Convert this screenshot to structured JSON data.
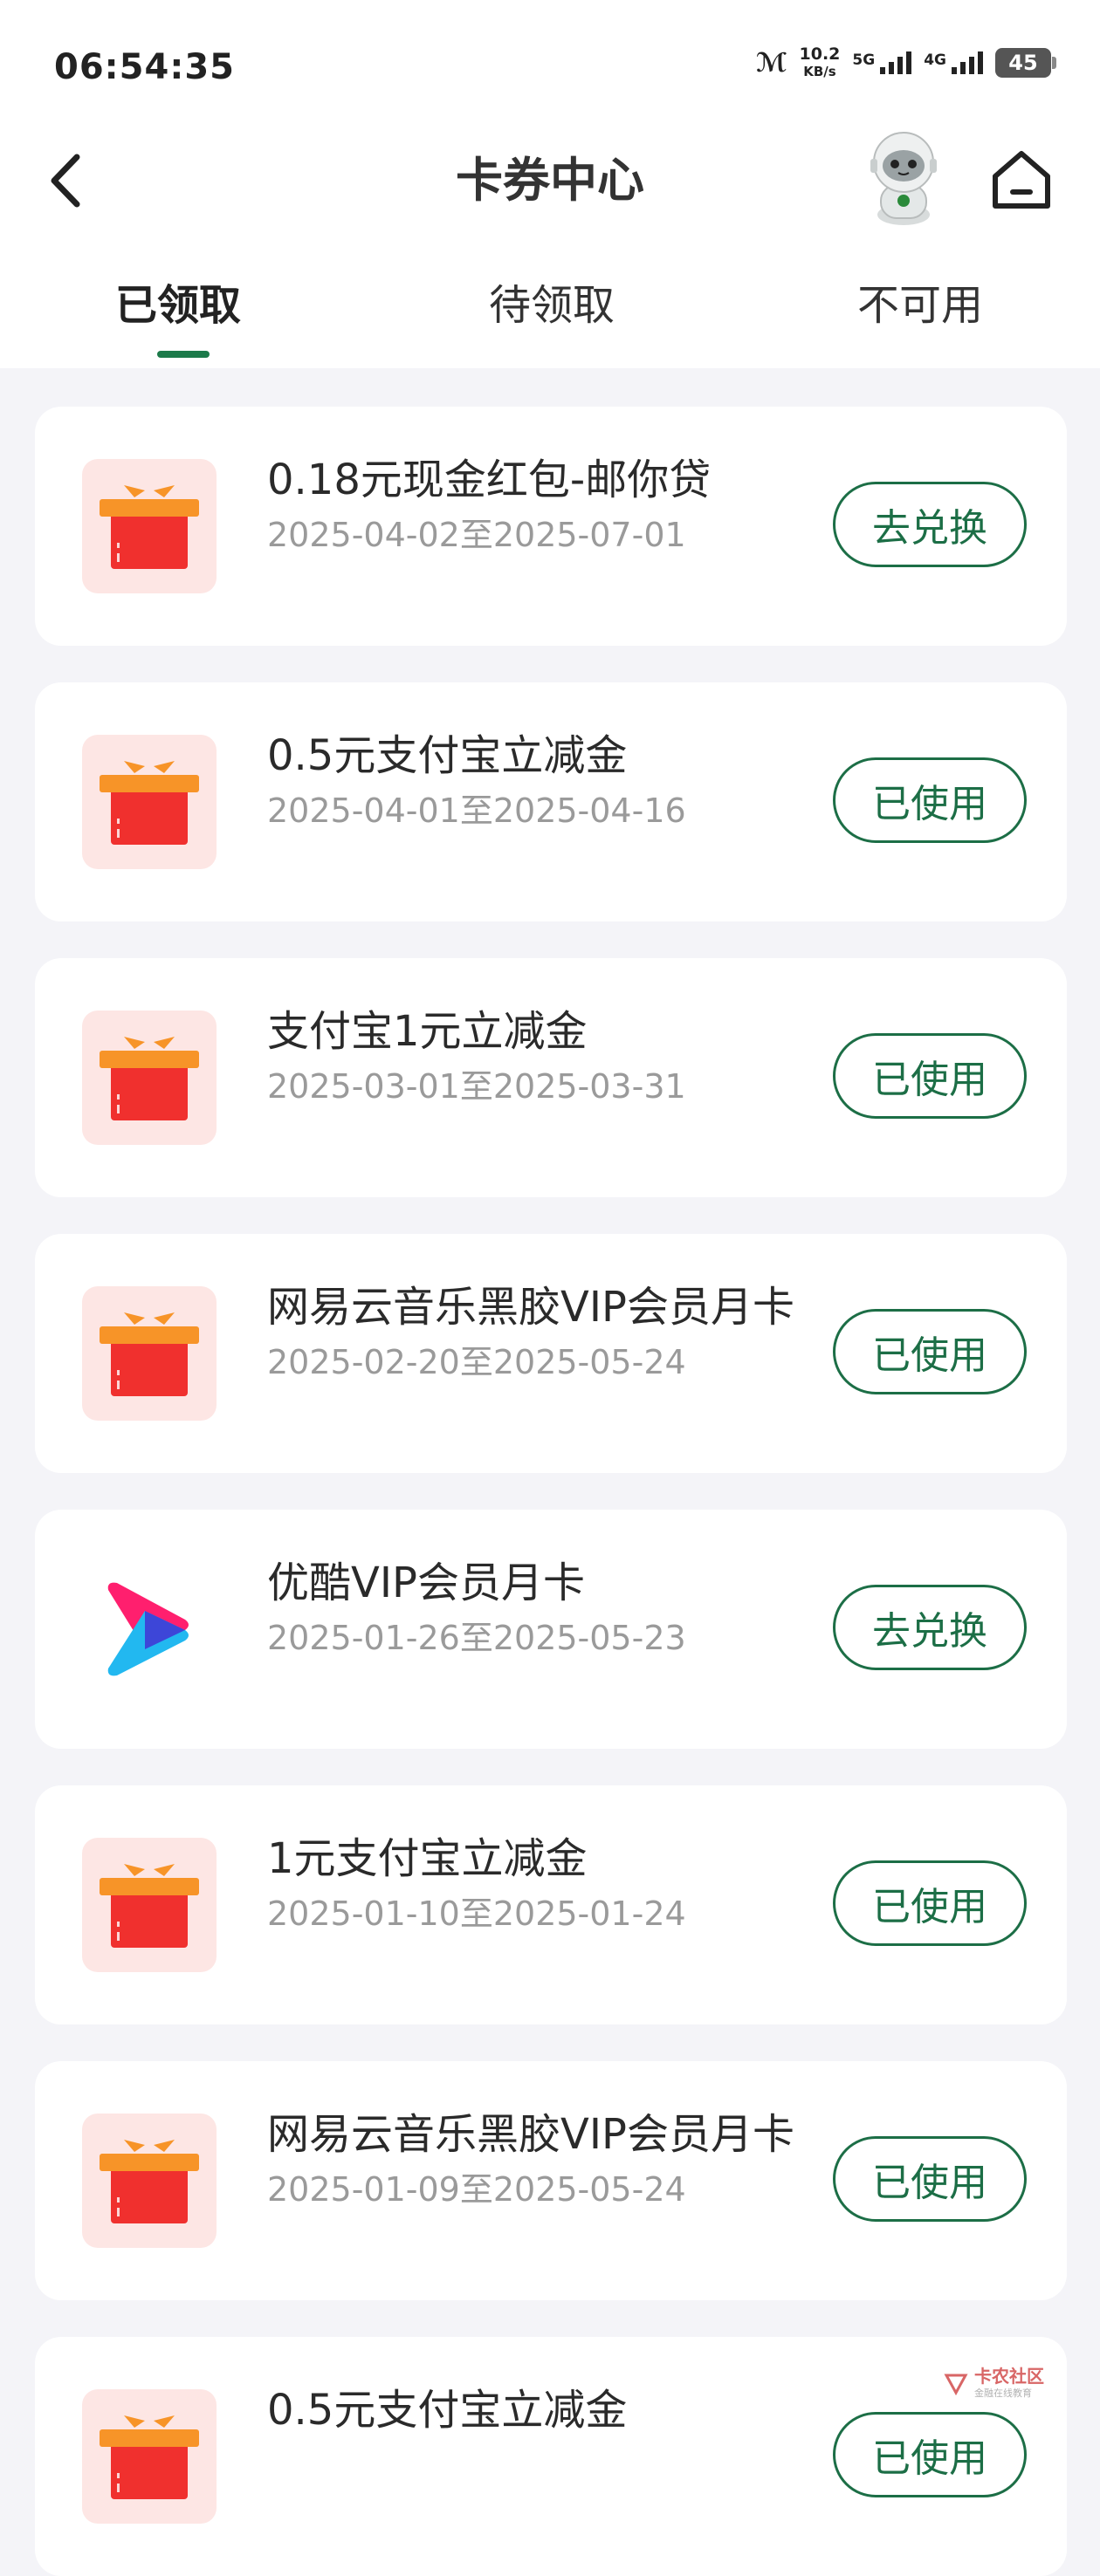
{
  "status_bar": {
    "time": "06:54:35",
    "net_speed_value": "10.2",
    "net_speed_unit": "KB/s",
    "sim1_label": "5G",
    "sim2_label": "4G",
    "battery": "45"
  },
  "header": {
    "title": "卡券中心"
  },
  "tabs": [
    {
      "label": "已领取",
      "active": true
    },
    {
      "label": "待领取",
      "active": false
    },
    {
      "label": "不可用",
      "active": false
    }
  ],
  "coupons": [
    {
      "icon": "gift-icon",
      "title": "0.18元现金红包-邮你贷",
      "date": "2025-04-02至2025-07-01",
      "action": "去兑换"
    },
    {
      "icon": "gift-icon",
      "title": "0.5元支付宝立减金",
      "date": "2025-04-01至2025-04-16",
      "action": "已使用"
    },
    {
      "icon": "gift-icon",
      "title": "支付宝1元立减金",
      "date": "2025-03-01至2025-03-31",
      "action": "已使用"
    },
    {
      "icon": "gift-icon",
      "title": "网易云音乐黑胶VIP会员月卡",
      "date": "2025-02-20至2025-05-24",
      "action": "已使用"
    },
    {
      "icon": "youku-logo-icon",
      "title": "优酷VIP会员月卡",
      "date": "2025-01-26至2025-05-23",
      "action": "去兑换"
    },
    {
      "icon": "gift-icon",
      "title": "1元支付宝立减金",
      "date": "2025-01-10至2025-01-24",
      "action": "已使用"
    },
    {
      "icon": "gift-icon",
      "title": "网易云音乐黑胶VIP会员月卡",
      "date": "2025-01-09至2025-05-24",
      "action": "已使用"
    },
    {
      "icon": "gift-icon",
      "title": "0.5元支付宝立减金",
      "date": "",
      "action": "已使用"
    }
  ],
  "watermark": {
    "text": "卡农社区",
    "sub": "金融在线教育"
  },
  "colors": {
    "accent_green": "#1c6e46",
    "tab_indicator": "#1c7a4a",
    "gift_red": "#f0302e",
    "gift_orange": "#f79428",
    "icon_bg": "#fde6e4",
    "page_bg": "#f4f4f8"
  }
}
